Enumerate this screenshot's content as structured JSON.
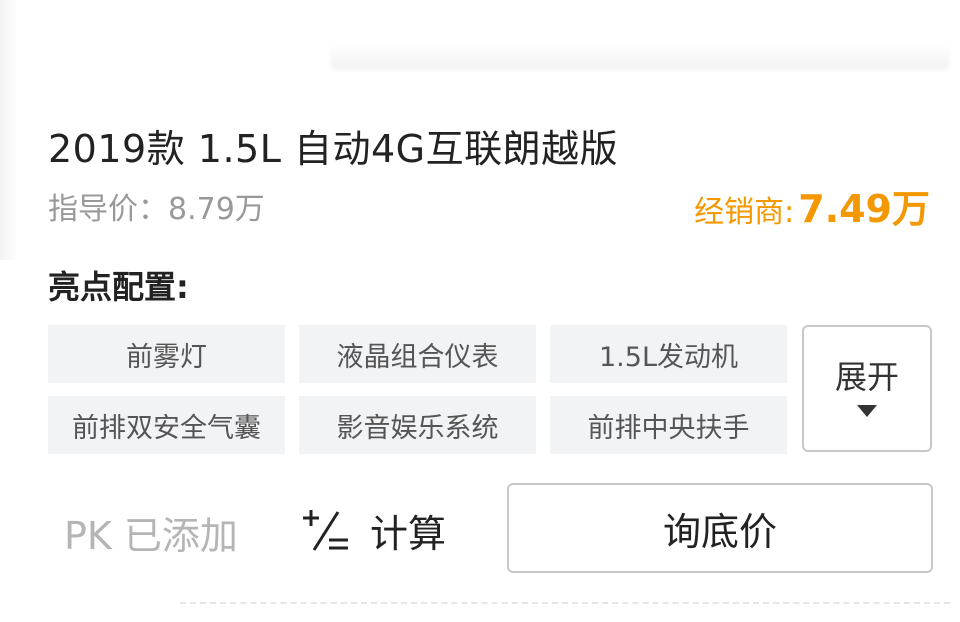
{
  "car": {
    "title": "2019款 1.5L 自动4G互联朗越版",
    "guide_price": "指导价：8.79万",
    "dealer_label": "经销商:",
    "dealer_price": "7.49万"
  },
  "highlights": {
    "title": "亮点配置:",
    "tags": [
      "前雾灯",
      "液晶组合仪表",
      "1.5L发动机",
      "前排双安全气囊",
      "影音娱乐系统",
      "前排中央扶手"
    ],
    "expand_label": "展开"
  },
  "actions": {
    "pk_label": "PK 已添加",
    "calc_label": "计算",
    "calc_icon": "calculator-icon",
    "inquire_label": "询底价"
  },
  "colors": {
    "accent": "#f39800",
    "tag_bg": "#f2f3f5",
    "muted_text": "#999999"
  }
}
